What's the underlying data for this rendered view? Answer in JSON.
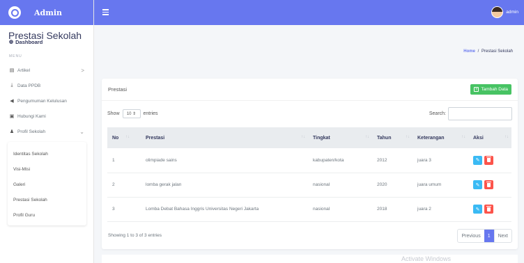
{
  "brand": {
    "name": "Admin"
  },
  "topbar": {
    "user_name": "admin"
  },
  "sidebar": {
    "dashboard": "Dashboard",
    "menu_label": "MENU",
    "items": [
      {
        "label": "Artikel",
        "icon": "newspaper-icon",
        "chevron": ">"
      },
      {
        "label": "Data PPDB",
        "icon": "download-icon"
      },
      {
        "label": "Pengumuman Kelulusan",
        "icon": "megaphone-icon"
      },
      {
        "label": "Hubungi Kami",
        "icon": "contact-card-icon"
      },
      {
        "label": "Profil Sekolah",
        "icon": "users-icon",
        "chevron": "⌄"
      }
    ],
    "submenu": [
      "Identitas Sekolah",
      "Visi-Misi",
      "Galeri",
      "Prestasi Sekolah",
      "Profil Guru"
    ]
  },
  "header": {
    "title": "Prestasi Sekolah",
    "breadcrumb_home": "Home",
    "breadcrumb_sep": "/",
    "breadcrumb_current": "Prestasi Sekolah"
  },
  "card": {
    "title": "Prestasi",
    "add_button": "Tambah Data",
    "show_label": "Show",
    "entries_value": "10 ⇕",
    "entries_label": "entries",
    "search_label": "Search:",
    "columns": [
      "No",
      "Prestasi",
      "Tingkat",
      "Tahun",
      "Keterangan",
      "Aksi"
    ],
    "rows": [
      {
        "no": "1",
        "prestasi": "olimpiade sains",
        "tingkat": "kabupaten/kota",
        "tahun": "2012",
        "keterangan": "juara 3"
      },
      {
        "no": "2",
        "prestasi": "lomba gerak jalan",
        "tingkat": "nasional",
        "tahun": "2020",
        "keterangan": "juara umum"
      },
      {
        "no": "3",
        "prestasi": "Lomba Debat Bahasa Inggris Universitas Negeri Jakarta",
        "tingkat": "nasional",
        "tahun": "2018",
        "keterangan": "juara 2"
      }
    ],
    "info": "Showing 1 to 3 of 3 entries",
    "pager": {
      "previous": "Previous",
      "current": "1",
      "next": "Next"
    }
  },
  "watermark": "Activate Windows",
  "colors": {
    "accent": "#6777ef",
    "success": "#47c363",
    "info": "#3abaf4",
    "danger": "#fc544b"
  }
}
